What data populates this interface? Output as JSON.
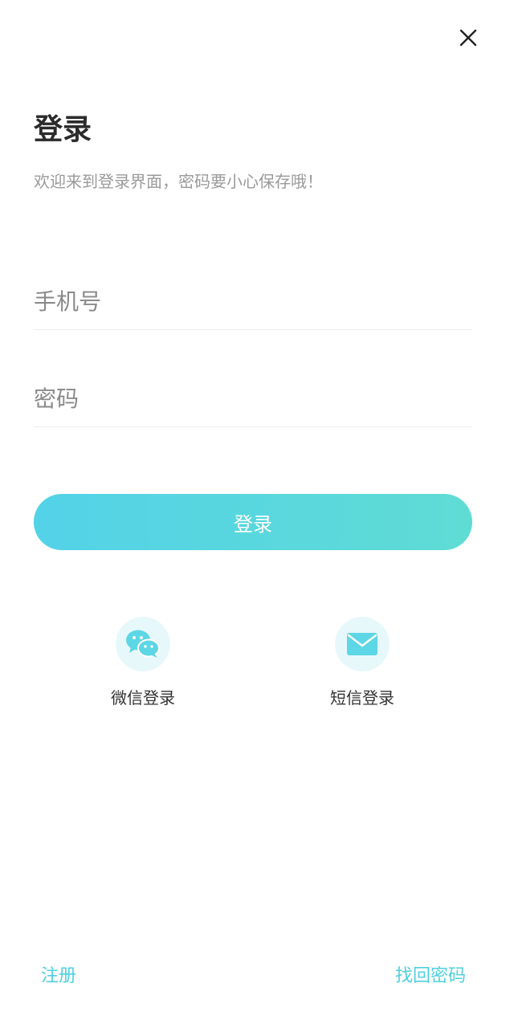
{
  "header": {
    "close_icon": "close-icon"
  },
  "title": "登录",
  "subtitle": "欢迎来到登录界面，密码要小心保存哦！",
  "form": {
    "phone_placeholder": "手机号",
    "phone_value": "",
    "password_placeholder": "密码",
    "password_value": ""
  },
  "login_button": {
    "label": "登录"
  },
  "social_login": {
    "wechat": {
      "icon": "wechat-icon",
      "label": "微信登录"
    },
    "sms": {
      "icon": "envelope-icon",
      "label": "短信登录"
    }
  },
  "footer": {
    "register": "注册",
    "forgot_password": "找回密码"
  },
  "colors": {
    "accent": "#53d2e8",
    "accent_end": "#5fdcd4",
    "icon_circle": "#e7f8fb",
    "link": "#4fd0e0"
  }
}
